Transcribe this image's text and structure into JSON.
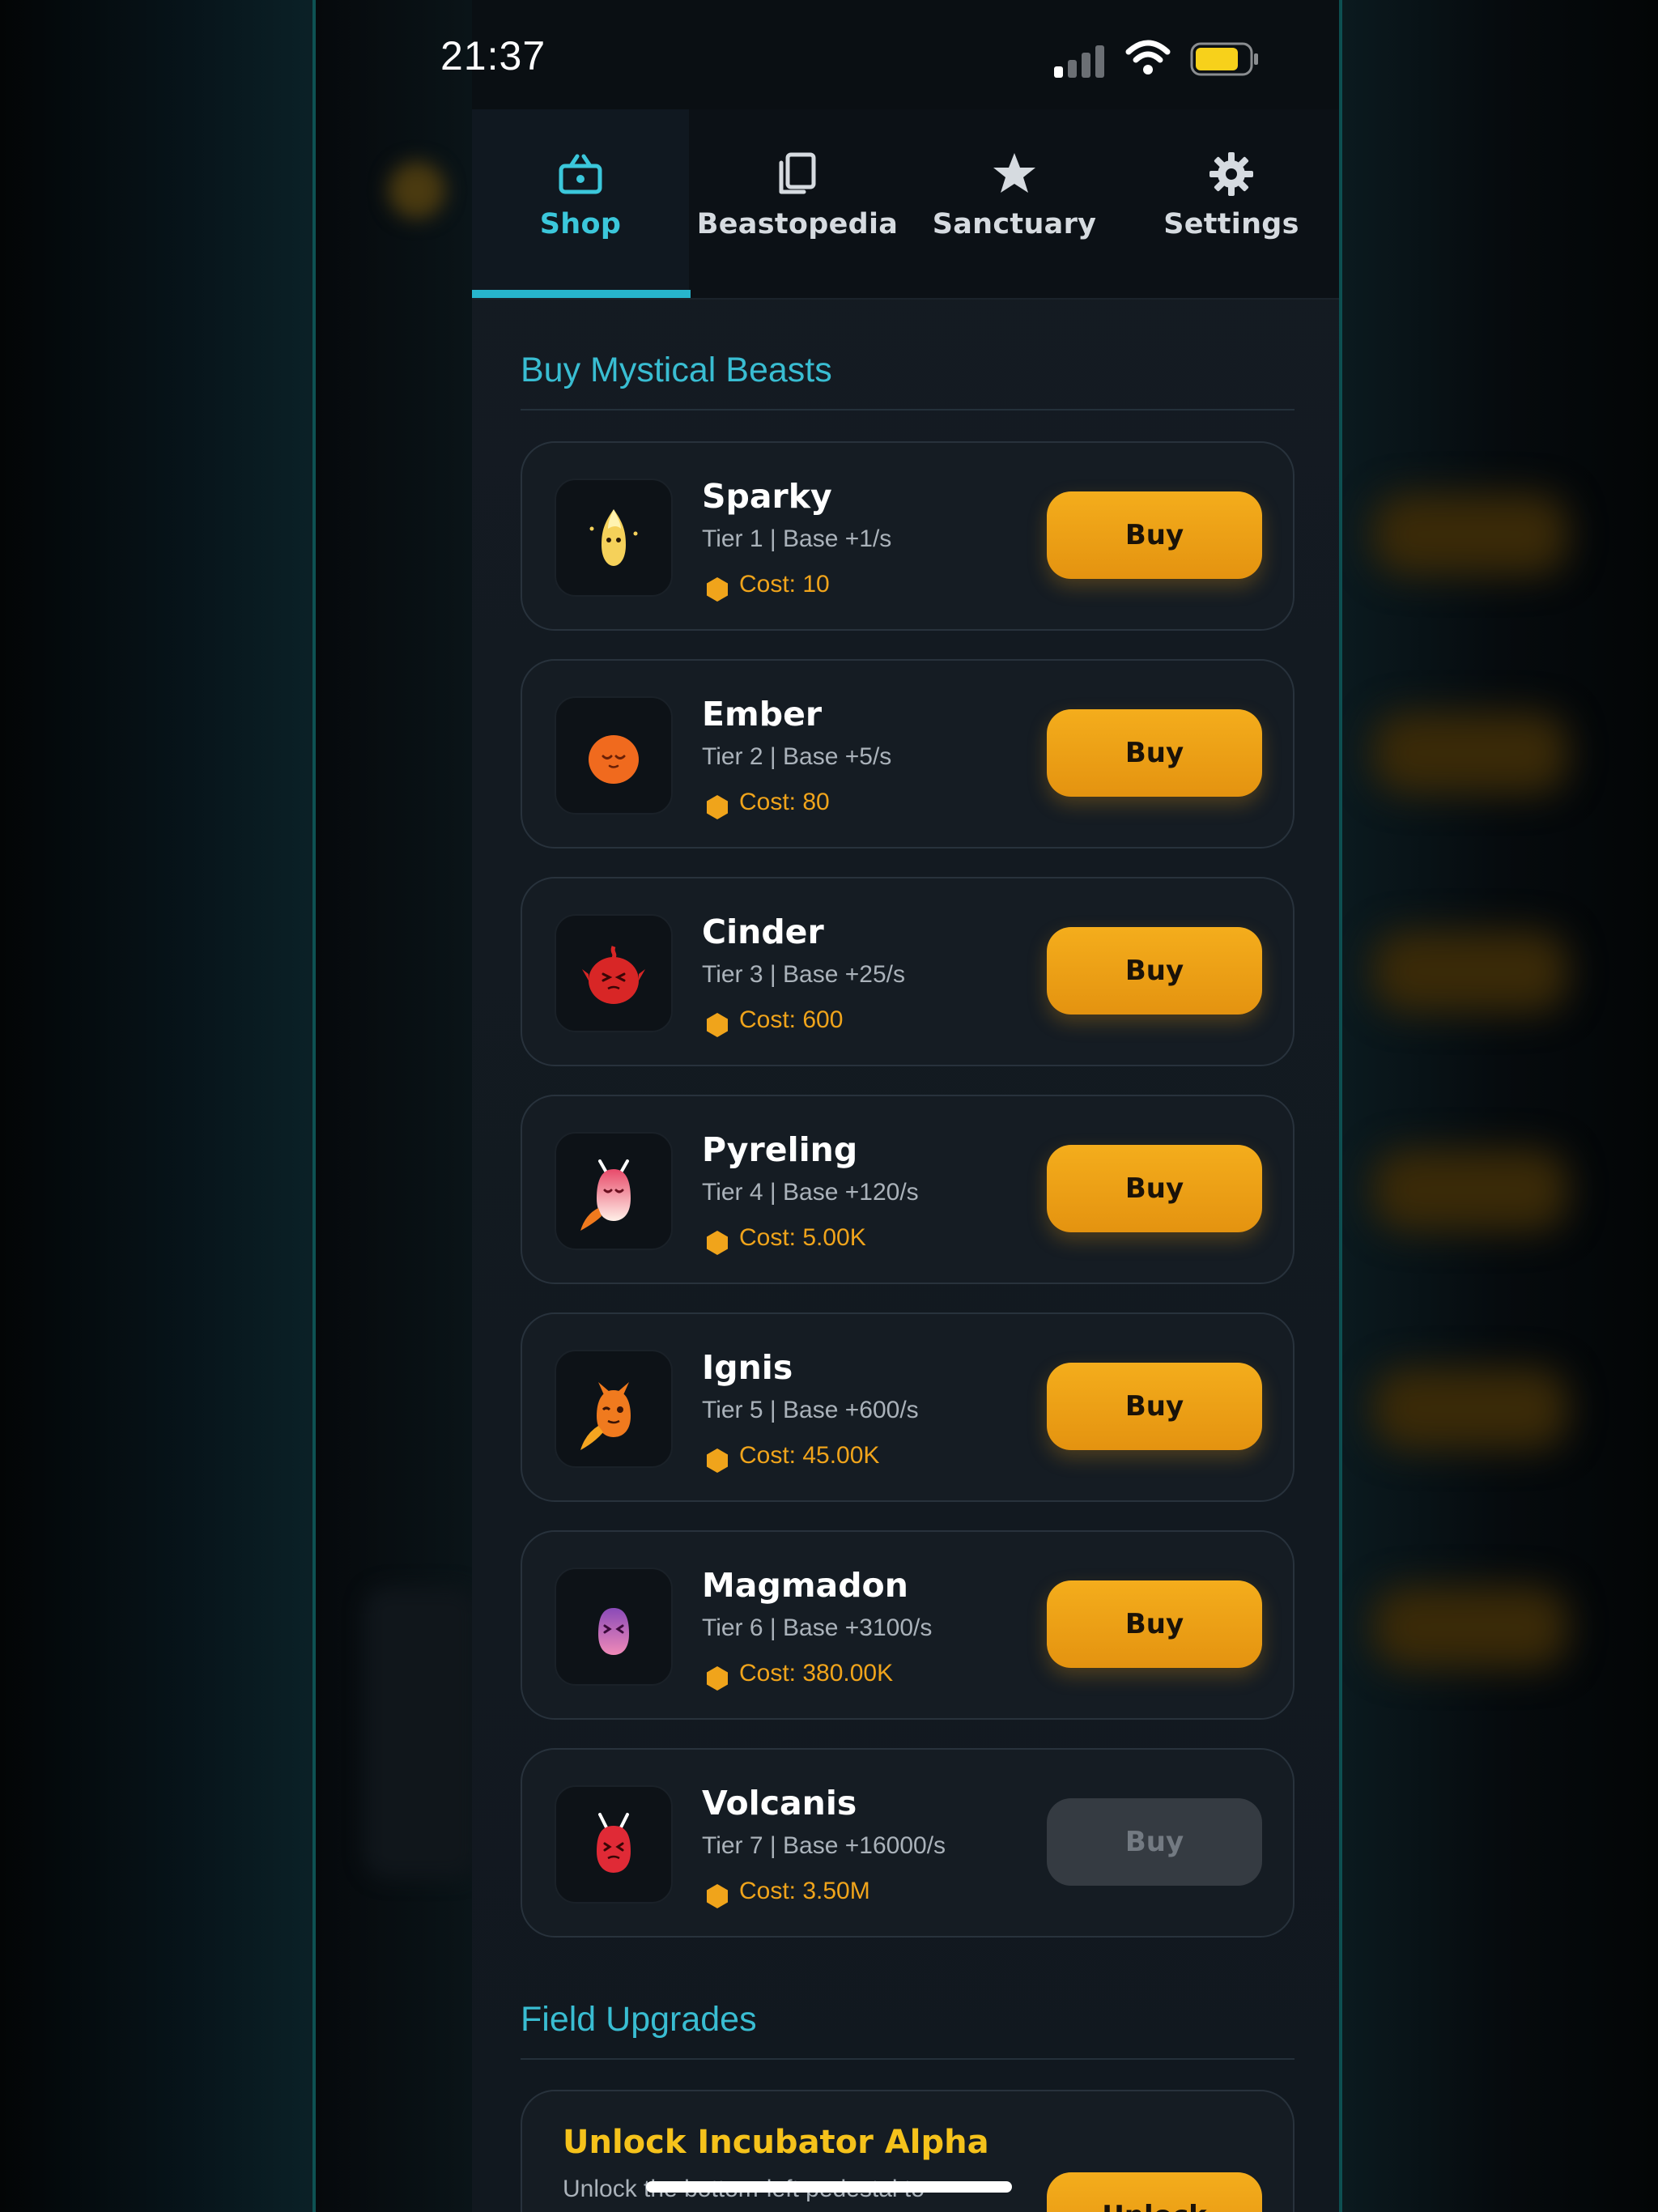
{
  "status_bar": {
    "time": "21:37"
  },
  "tabs": [
    {
      "label": "Shop",
      "icon": "shop-icon",
      "active": true
    },
    {
      "label": "Beastopedia",
      "icon": "copy-icon",
      "active": false
    },
    {
      "label": "Sanctuary",
      "icon": "star-icon",
      "active": false
    },
    {
      "label": "Settings",
      "icon": "gear-icon",
      "active": false
    }
  ],
  "shop": {
    "title": "Buy Mystical Beasts",
    "beasts": [
      {
        "name": "Sparky",
        "info": "Tier 1 | Base +1/s",
        "cost": "Cost: 10",
        "buy_label": "Buy",
        "enabled": true,
        "color": "#f5d15a"
      },
      {
        "name": "Ember",
        "info": "Tier 2 | Base +5/s",
        "cost": "Cost: 80",
        "buy_label": "Buy",
        "enabled": true,
        "color": "#f06a1e"
      },
      {
        "name": "Cinder",
        "info": "Tier 3 | Base +25/s",
        "cost": "Cost: 600",
        "buy_label": "Buy",
        "enabled": true,
        "color": "#d82626"
      },
      {
        "name": "Pyreling",
        "info": "Tier 4 | Base +120/s",
        "cost": "Cost: 5.00K",
        "buy_label": "Buy",
        "enabled": true,
        "color": "#f2a4b2"
      },
      {
        "name": "Ignis",
        "info": "Tier 5 | Base +600/s",
        "cost": "Cost: 45.00K",
        "buy_label": "Buy",
        "enabled": true,
        "color": "#f07a1e"
      },
      {
        "name": "Magmadon",
        "info": "Tier 6 | Base +3100/s",
        "cost": "Cost: 380.00K",
        "buy_label": "Buy",
        "enabled": true,
        "color": "#c466c8"
      },
      {
        "name": "Volcanis",
        "info": "Tier 7 | Base +16000/s",
        "cost": "Cost: 3.50M",
        "buy_label": "Buy",
        "enabled": false,
        "color": "#e02a36"
      }
    ]
  },
  "upgrades": {
    "title": "Field Upgrades",
    "item": {
      "title": "Unlock Incubator Alpha",
      "desc": "Unlock the bottom-left pedestal to",
      "button": "Unlock"
    }
  },
  "colors": {
    "accent": "#3bc7db",
    "buy": "#f0a41b",
    "cost": "#f0a41b"
  }
}
